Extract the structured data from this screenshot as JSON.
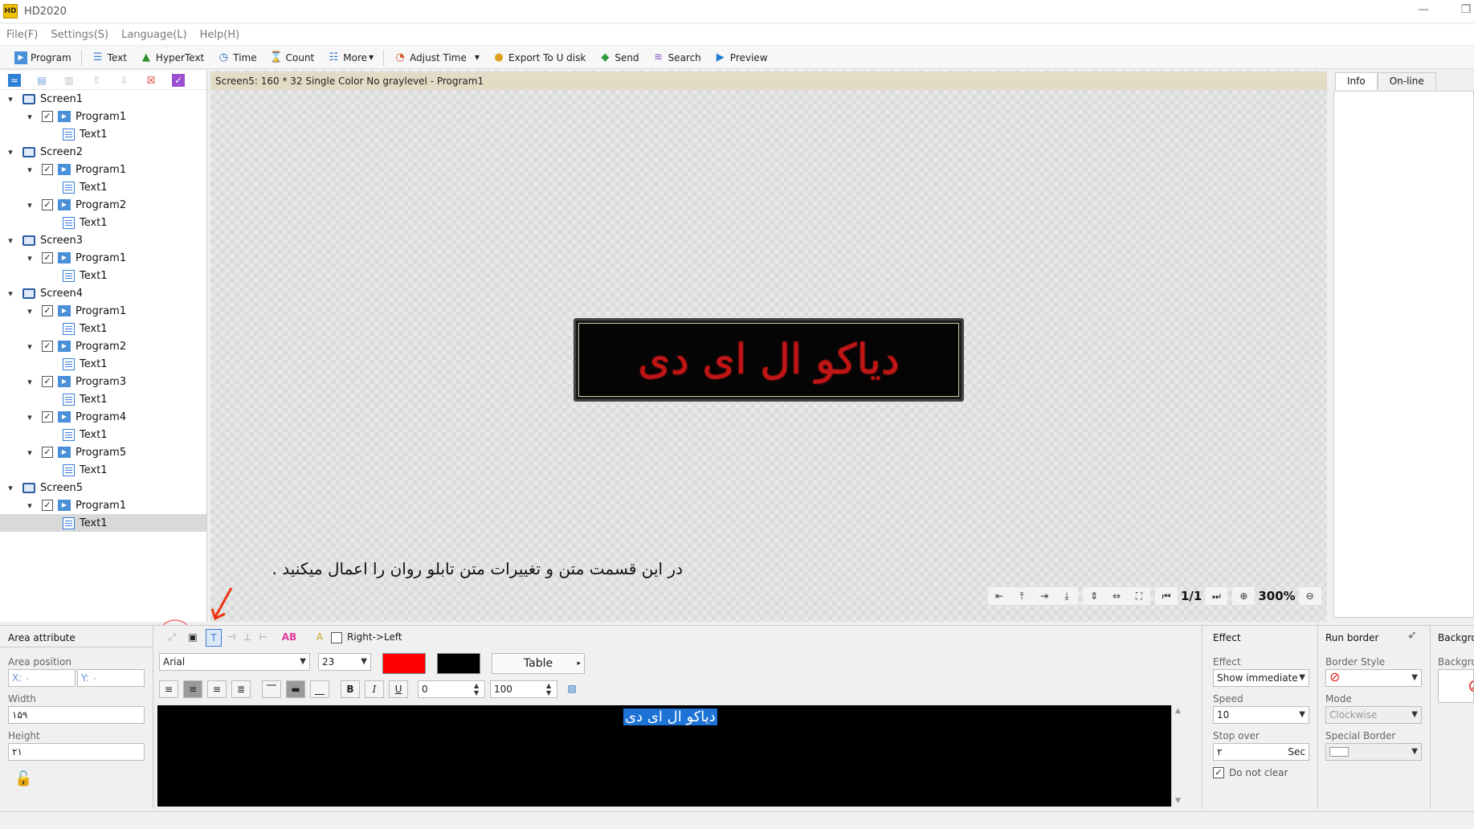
{
  "app": {
    "title": "HD2020"
  },
  "menu": [
    "File(F)",
    "Settings(S)",
    "Language(L)",
    "Help(H)"
  ],
  "toolbar": {
    "program": "Program",
    "text": "Text",
    "hypertext": "HyperText",
    "time": "Time",
    "count": "Count",
    "more": "More",
    "adjust_time": "Adjust Time",
    "export": "Export To U disk",
    "send": "Send",
    "search": "Search",
    "preview": "Preview"
  },
  "tree": [
    {
      "type": "screen",
      "label": "Screen1",
      "level": 0
    },
    {
      "type": "program",
      "label": "Program1",
      "level": 1
    },
    {
      "type": "text",
      "label": "Text1",
      "level": 2
    },
    {
      "type": "screen",
      "label": "Screen2",
      "level": 0
    },
    {
      "type": "program",
      "label": "Program1",
      "level": 1
    },
    {
      "type": "text",
      "label": "Text1",
      "level": 2
    },
    {
      "type": "program",
      "label": "Program2",
      "level": 1
    },
    {
      "type": "text",
      "label": "Text1",
      "level": 2
    },
    {
      "type": "screen",
      "label": "Screen3",
      "level": 0
    },
    {
      "type": "program",
      "label": "Program1",
      "level": 1
    },
    {
      "type": "text",
      "label": "Text1",
      "level": 2
    },
    {
      "type": "screen",
      "label": "Screen4",
      "level": 0
    },
    {
      "type": "program",
      "label": "Program1",
      "level": 1
    },
    {
      "type": "text",
      "label": "Text1",
      "level": 2
    },
    {
      "type": "program",
      "label": "Program2",
      "level": 1
    },
    {
      "type": "text",
      "label": "Text1",
      "level": 2
    },
    {
      "type": "program",
      "label": "Program3",
      "level": 1
    },
    {
      "type": "text",
      "label": "Text1",
      "level": 2
    },
    {
      "type": "program",
      "label": "Program4",
      "level": 1
    },
    {
      "type": "text",
      "label": "Text1",
      "level": 2
    },
    {
      "type": "program",
      "label": "Program5",
      "level": 1
    },
    {
      "type": "text",
      "label": "Text1",
      "level": 2
    },
    {
      "type": "screen",
      "label": "Screen5",
      "level": 0
    },
    {
      "type": "program",
      "label": "Program1",
      "level": 1
    },
    {
      "type": "text",
      "label": "Text1",
      "level": 2,
      "selected": true
    }
  ],
  "canvas": {
    "header": "Screen5: 160 * 32 Single Color No graylevel - Program1",
    "led_text": "دیاکو ال ای دی",
    "annotation": "در این قسمت متن و تغییرات متن تابلو روان را اعمال میکنید .",
    "page": "1/1",
    "zoom": "300%"
  },
  "info_tabs": [
    "Info",
    "On-line"
  ],
  "area": {
    "title": "Area attribute",
    "position_label": "Area position",
    "x": "X: ۰",
    "y": "Y: ۰",
    "width_label": "Width",
    "width": "۱۵۹",
    "height_label": "Height",
    "height": "۲۱"
  },
  "text_editor": {
    "right_to_left": "Right->Left",
    "font": "Arial",
    "size": "23",
    "fg_color": "#ff0000",
    "bg_color": "#000000",
    "table_label": "Table",
    "spacing": "0",
    "scale": "100",
    "content": "دیاکو ال ای دی"
  },
  "effect": {
    "title": "Effect",
    "effect_label": "Effect",
    "effect_value": "Show immediate",
    "speed_label": "Speed",
    "speed_value": "10",
    "stop_label": "Stop over",
    "stop_value": "۲",
    "stop_unit": "Sec",
    "do_not_clear": "Do not clear"
  },
  "run_border": {
    "title": "Run border",
    "style_label": "Border Style",
    "mode_label": "Mode",
    "mode_value": "Clockwise",
    "special_label": "Special Border"
  },
  "background": {
    "title": "Backgro",
    "label": "Backgro"
  }
}
